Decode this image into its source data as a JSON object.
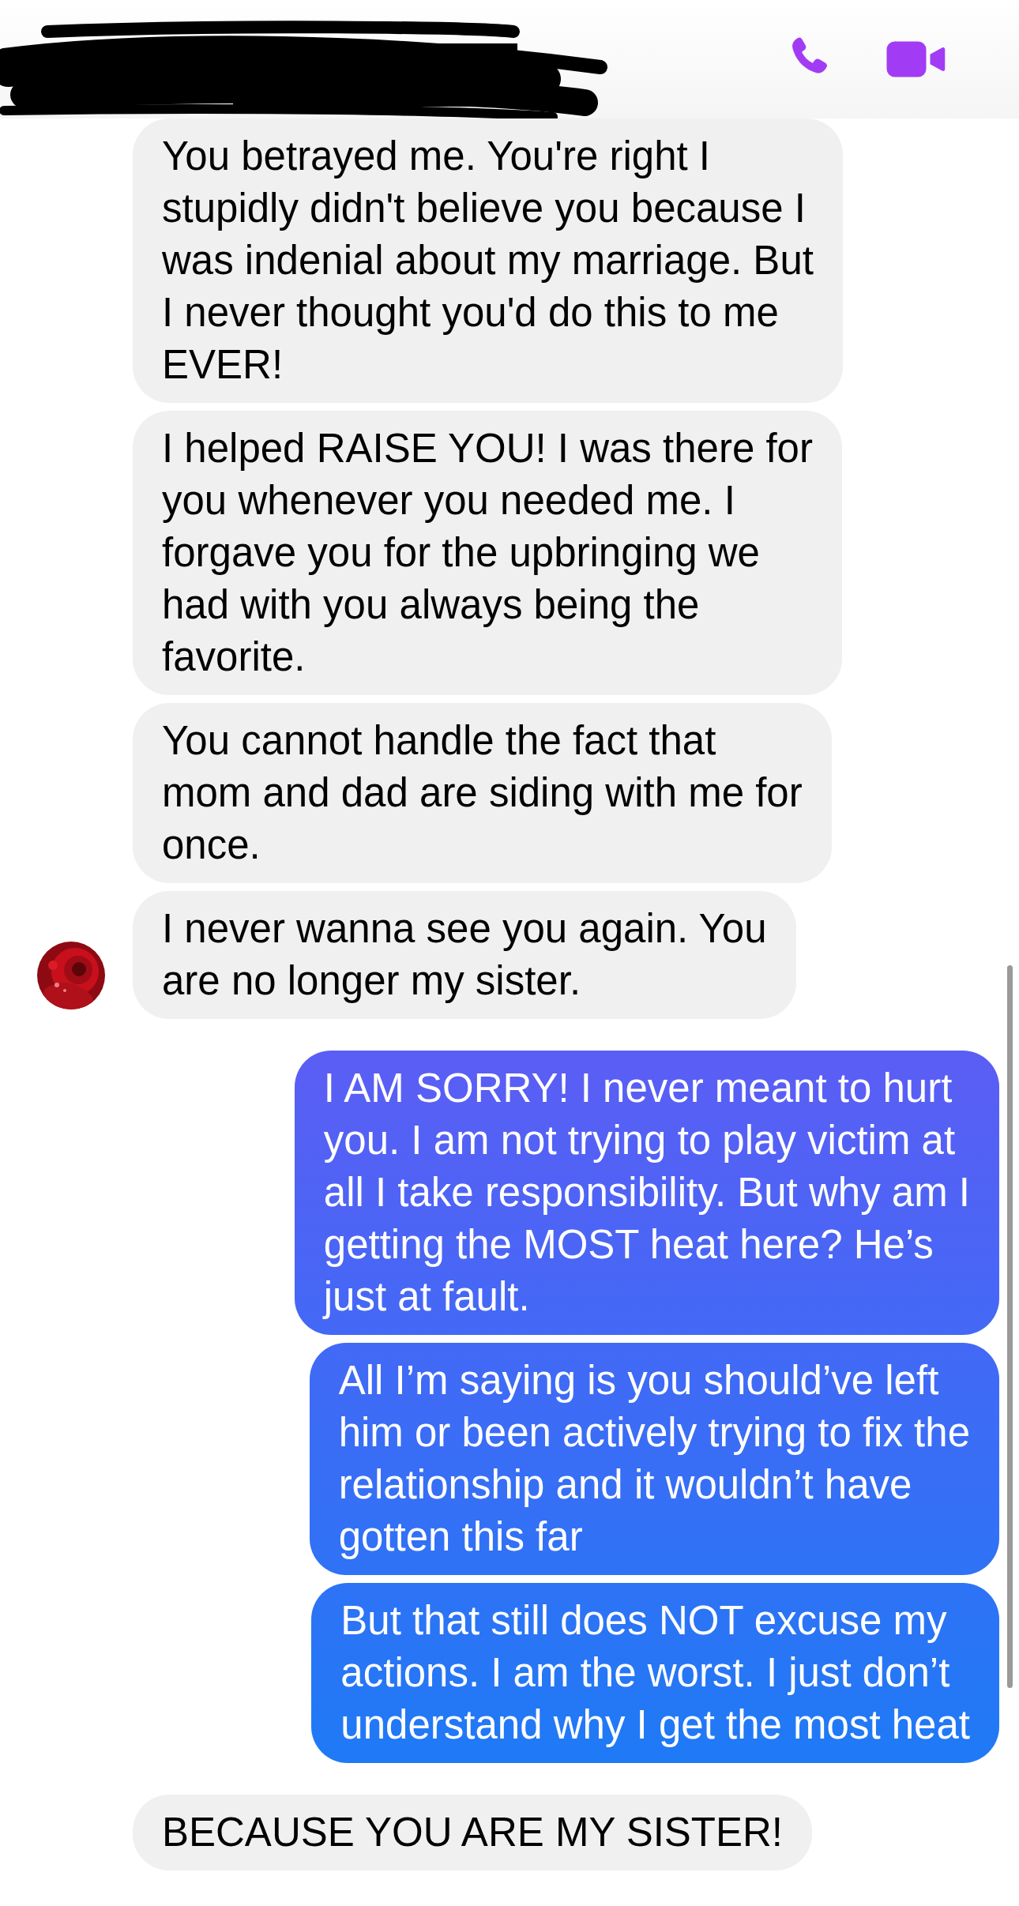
{
  "header": {
    "actions": [
      {
        "kind": "call"
      },
      {
        "kind": "video"
      }
    ]
  },
  "messages": [
    {
      "kind": "incoming",
      "show_avatar": false,
      "lines": [
        "You betrayed me. You're right I",
        "stupidly didn't believe you because I",
        "was indenial about my marriage. But",
        "I never thought you'd do this to me",
        "EVER!"
      ]
    },
    {
      "kind": "incoming",
      "show_avatar": false,
      "lines": [
        "I helped RAISE YOU! I was there for",
        "you whenever you needed me. I",
        "forgave you for the upbringing we",
        "had with you always being the",
        "favorite."
      ]
    },
    {
      "kind": "incoming",
      "show_avatar": false,
      "lines": [
        "You cannot handle the fact that",
        "mom and dad are siding with me for",
        "once."
      ]
    },
    {
      "kind": "incoming",
      "show_avatar": true,
      "lines": [
        "I never wanna see you again. You",
        "are no longer my sister."
      ]
    },
    {
      "kind": "outgoing",
      "show_avatar": false,
      "lines": [
        "I AM SORRY! I never meant to hurt",
        "you. I am not trying to play victim at",
        "all I take responsibility. But why am I",
        "getting the MOST heat here? He’s",
        "just at fault."
      ]
    },
    {
      "kind": "outgoing",
      "show_avatar": false,
      "lines": [
        "All I’m saying is you should’ve left",
        "him or been actively trying to fix the",
        "relationship and it wouldn’t have",
        "gotten this far"
      ]
    },
    {
      "kind": "outgoing",
      "show_avatar": false,
      "lines": [
        "But that still does NOT excuse my",
        "actions. I am the worst. I just don’t",
        "understand why I get the most heat"
      ]
    },
    {
      "kind": "incoming",
      "show_avatar": false,
      "lines": [
        "BECAUSE YOU ARE MY SISTER!"
      ]
    }
  ]
}
